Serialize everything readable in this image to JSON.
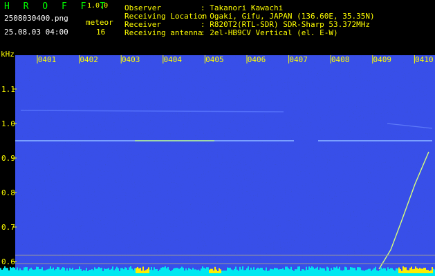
{
  "header": {
    "app_name": "H R O F F T",
    "version": "1.0.0",
    "filename": "2508030400.png",
    "datetime": "25.08.03 04:00",
    "meteor_label": "meteor",
    "meteor_count": "16",
    "info": [
      {
        "label": "Observer",
        "value": ": Takanori Kawachi"
      },
      {
        "label": "Receiving Location",
        "value": ": Ogaki, Gifu, JAPAN (136.60E, 35.35N)"
      },
      {
        "label": "Receiver",
        "value": ": R820T2(RTL-SDR) SDR-Sharp 53.372MHz"
      },
      {
        "label": "Receiving antenna",
        "value": ": 2el-HB9CV Vertical (el. E-W)"
      }
    ]
  },
  "spectrogram": {
    "y_unit": "kHz",
    "y_ticks": [
      "1.1",
      "1.0",
      "0.9",
      "0.8",
      "0.7",
      "0.6"
    ],
    "time_labels": [
      "0401",
      "0402",
      "0403",
      "0404",
      "0405",
      "0406",
      "0407",
      "0408",
      "0409",
      "0410"
    ]
  }
}
